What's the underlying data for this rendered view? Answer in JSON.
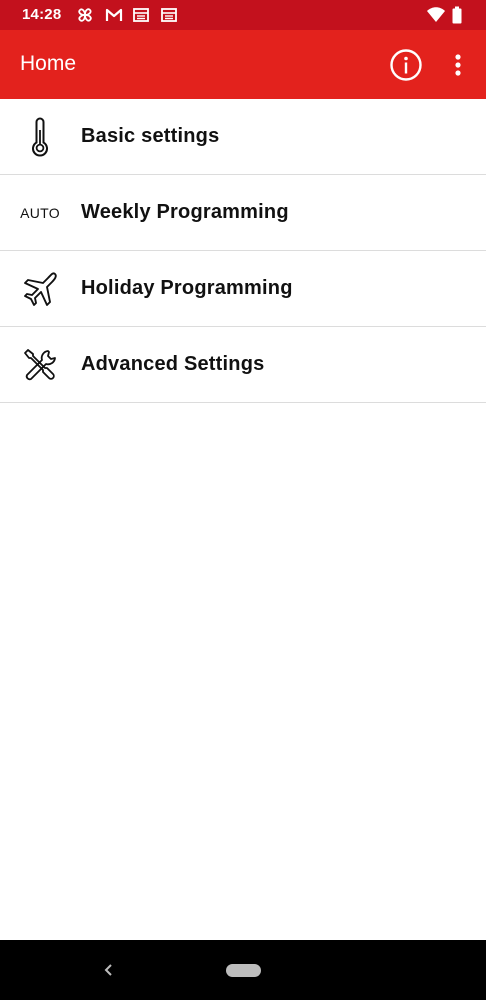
{
  "status_bar": {
    "time": "14:28",
    "icons": [
      "pinwheel-icon",
      "gmail-icon",
      "news-icon",
      "news-icon",
      "wifi-icon",
      "battery-icon"
    ],
    "background_color": "#c3111d"
  },
  "app_bar": {
    "title": "Home",
    "background_color": "#e3221d",
    "actions": [
      "info-icon",
      "more-vert-icon"
    ]
  },
  "menu": {
    "items": [
      {
        "label": "Basic settings",
        "icon": "thermometer-icon"
      },
      {
        "label": "Weekly Programming",
        "icon_text": "AUTO"
      },
      {
        "label": "Holiday Programming",
        "icon": "airplane-icon"
      },
      {
        "label": "Advanced Settings",
        "icon": "tools-icon"
      }
    ]
  },
  "nav_bar": {
    "buttons": [
      "back-icon",
      "home-pill"
    ]
  }
}
